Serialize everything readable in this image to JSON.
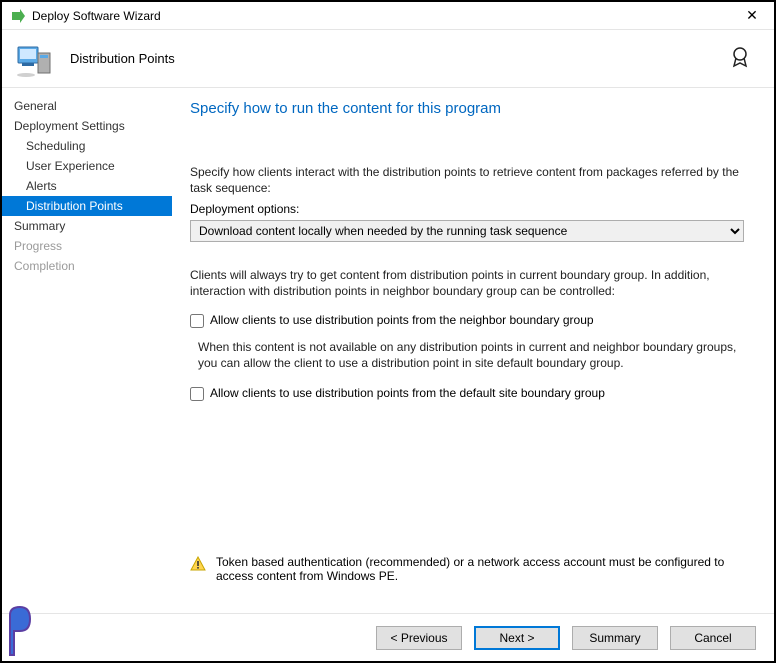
{
  "window": {
    "title": "Deploy Software Wizard",
    "step_title": "Distribution Points"
  },
  "sidebar": {
    "items": [
      {
        "label": "General",
        "sub": false,
        "selected": false,
        "disabled": false
      },
      {
        "label": "Deployment Settings",
        "sub": false,
        "selected": false,
        "disabled": false
      },
      {
        "label": "Scheduling",
        "sub": true,
        "selected": false,
        "disabled": false
      },
      {
        "label": "User Experience",
        "sub": true,
        "selected": false,
        "disabled": false
      },
      {
        "label": "Alerts",
        "sub": true,
        "selected": false,
        "disabled": false
      },
      {
        "label": "Distribution Points",
        "sub": true,
        "selected": true,
        "disabled": false
      },
      {
        "label": "Summary",
        "sub": false,
        "selected": false,
        "disabled": false
      },
      {
        "label": "Progress",
        "sub": false,
        "selected": false,
        "disabled": true
      },
      {
        "label": "Completion",
        "sub": false,
        "selected": false,
        "disabled": true
      }
    ]
  },
  "content": {
    "heading": "Specify how to run the content for this program",
    "intro": "Specify how clients interact with the distribution points to retrieve content from packages referred by the task sequence:",
    "deploy_label": "Deployment options:",
    "deploy_value": "Download content locally when needed by the running task sequence",
    "para2": "Clients will always try to get content from distribution points in current boundary group. In addition, interaction with distribution points in neighbor boundary group can be controlled:",
    "cb1_label": "Allow clients to use distribution points from the neighbor boundary group",
    "para3": "When this content is not available on any distribution points in current and neighbor boundary groups, you can allow the client to use a distribution point in site default boundary group.",
    "cb2_label": "Allow clients to use distribution points from the default site boundary group",
    "warn_text": "Token based authentication (recommended) or a network access account must be configured to access content from Windows PE."
  },
  "footer": {
    "prev": "< Previous",
    "next": "Next >",
    "summary": "Summary",
    "cancel": "Cancel"
  }
}
